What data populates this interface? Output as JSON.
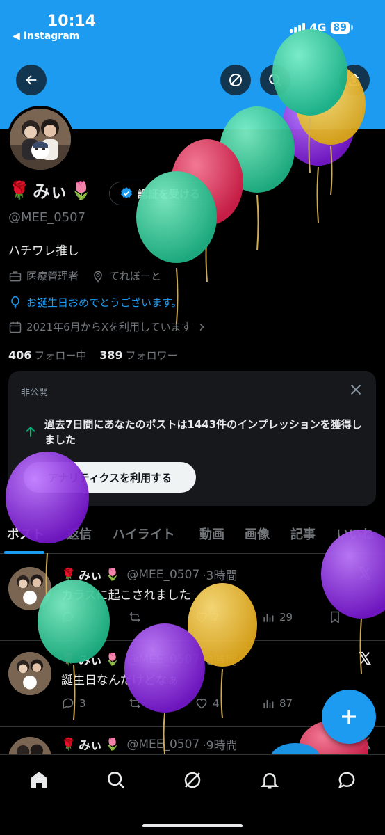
{
  "status": {
    "time": "10:14",
    "back_app": "◀ Instagram",
    "network": "4G",
    "battery": "89"
  },
  "profile": {
    "name": "みぃ",
    "handle": "@MEE_0507",
    "verify_label": "認証を受ける",
    "bio": "ハチワレ推し",
    "job": "医療管理者",
    "location": "てれぽーと",
    "birthday": "お誕生日おめでとうございます。",
    "joined": "2021年6月からXを利用しています",
    "following_count": "406",
    "following_label": "フォロー中",
    "followers_count": "389",
    "followers_label": "フォロワー"
  },
  "private_card": {
    "tag": "非公開",
    "message": "過去7日間にあなたのポストは1443件のインプレッションを獲得しました",
    "button": "アナリティクスを利用する"
  },
  "tabs": [
    "ポスト",
    "返信",
    "ハイライト",
    "動画",
    "画像",
    "記事",
    "いいね"
  ],
  "posts": [
    {
      "name": "みぃ",
      "handle": "@MEE_0507",
      "time": "·3時間",
      "text": "カラスに起こされました",
      "replies": "",
      "reposts": "",
      "likes": "2",
      "views": "29"
    },
    {
      "name": "みぃ",
      "handle": "@MEE_0507",
      "time": "·8時間",
      "text": "誕生日なんだけどなぁ",
      "replies": "3",
      "reposts": "",
      "likes": "4",
      "views": "87"
    },
    {
      "name": "みぃ",
      "handle": "@MEE_0507",
      "time": "·9時間",
      "text": "",
      "replies": "",
      "reposts": "",
      "likes": "",
      "views": ""
    }
  ],
  "colors": {
    "accent": "#1d9bf0",
    "background": "#000000",
    "muted": "#71767b",
    "balloon_green": "#2fd39c",
    "balloon_red": "#e8325a",
    "balloon_purple": "#8a2be2",
    "balloon_yellow": "#f2c12e"
  },
  "icons": [
    "back-arrow-icon",
    "grok-icon",
    "search-icon",
    "share-icon",
    "verified-badge-icon",
    "briefcase-icon",
    "location-pin-icon",
    "balloon-icon",
    "calendar-icon",
    "chevron-right-icon",
    "close-icon",
    "arrow-up-icon",
    "reply-icon",
    "repost-icon",
    "heart-icon",
    "views-icon",
    "bookmark-icon",
    "x-logo-icon",
    "plus-icon",
    "home-icon",
    "bell-icon",
    "messages-icon",
    "tulip-emoji",
    "rose-emoji"
  ]
}
